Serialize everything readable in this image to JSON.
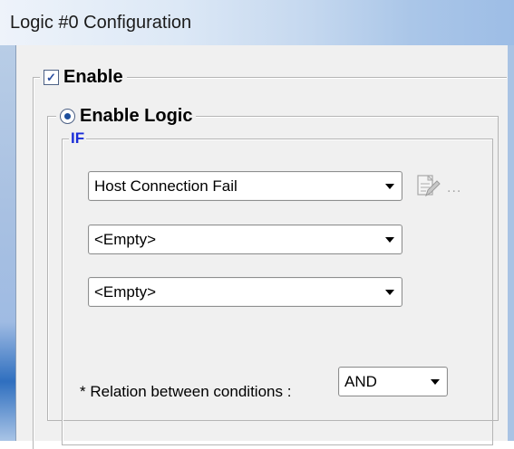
{
  "window": {
    "title": "Logic #0 Configuration"
  },
  "enable": {
    "label": "Enable",
    "checked": true
  },
  "logic": {
    "label": "Enable Logic",
    "selected": true
  },
  "if_group": {
    "label": "IF",
    "conditions": [
      "Host Connection Fail",
      "<Empty>",
      "<Empty>"
    ],
    "edit_icon": "edit-document-icon",
    "more_label": "..."
  },
  "relation": {
    "label": "* Relation between conditions :",
    "value": "AND"
  },
  "colors": {
    "if_label": "#1a2dd8",
    "titlebar_accent": "#9dbde6"
  }
}
